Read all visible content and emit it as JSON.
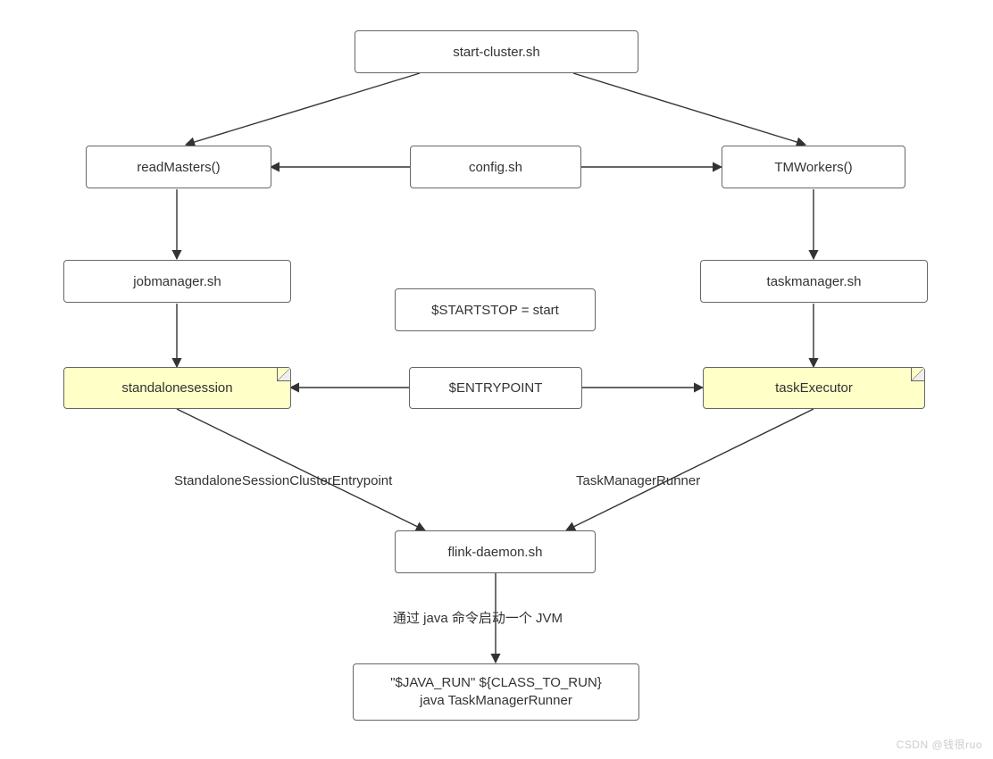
{
  "nodes": {
    "start_cluster": "start-cluster.sh",
    "read_masters": "readMasters()",
    "config_sh": "config.sh",
    "tm_workers": "TMWorkers()",
    "jobmanager_sh": "jobmanager.sh",
    "taskmanager_sh": "taskmanager.sh",
    "startstop": "$STARTSTOP   = start",
    "standalonesession": "standalonesession",
    "entrypoint": "$ENTRYPOINT",
    "task_executor": "taskExecutor",
    "flink_daemon": "flink-daemon.sh",
    "java_run": "\"$JAVA_RUN\" ${CLASS_TO_RUN}\njava TaskManagerRunner"
  },
  "labels": {
    "standalone_entrypoint": "StandaloneSessionClusterEntrypoint",
    "task_manager_runner": "TaskManagerRunner",
    "java_cmd": "通过 java 命令启动一个 JVM"
  },
  "watermark": "CSDN @钱很ruo"
}
